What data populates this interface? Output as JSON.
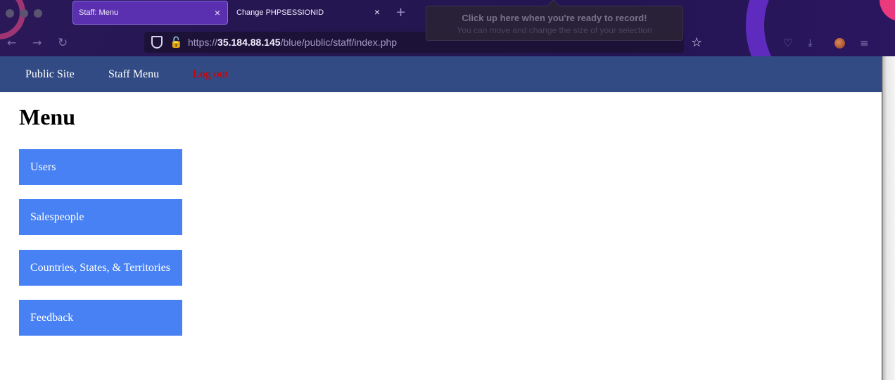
{
  "browser": {
    "tabs": [
      {
        "title": "Staff: Menu",
        "active": true
      },
      {
        "title": "Change PHPSESSIONID",
        "active": false
      }
    ],
    "close_glyph": "×",
    "new_tab_glyph": "+",
    "url_scheme": "https://",
    "url_host": "35.184.88.145",
    "url_path": "/blue/public/staff/index.php",
    "icons": {
      "back": "←",
      "forward": "→",
      "reload": "↻",
      "lock": "🔓",
      "bookmark": "☆",
      "pocket": "♡",
      "download": "⤓",
      "menu": "≡"
    }
  },
  "recording_tip": {
    "title": "Click up here when you're ready to record!",
    "subtitle": "You can move and change the size of your selection"
  },
  "site_nav": {
    "public_site": "Public Site",
    "staff_menu": "Staff Menu",
    "log_out": "Log out"
  },
  "page": {
    "title": "Menu",
    "menu_items": [
      {
        "label": "Users"
      },
      {
        "label": "Salespeople"
      },
      {
        "label": "Countries, States, & Territories"
      },
      {
        "label": "Feedback"
      }
    ]
  },
  "colors": {
    "nav_bg": "#324b85",
    "button_bg": "#4881f3",
    "logout": "#d00000"
  }
}
